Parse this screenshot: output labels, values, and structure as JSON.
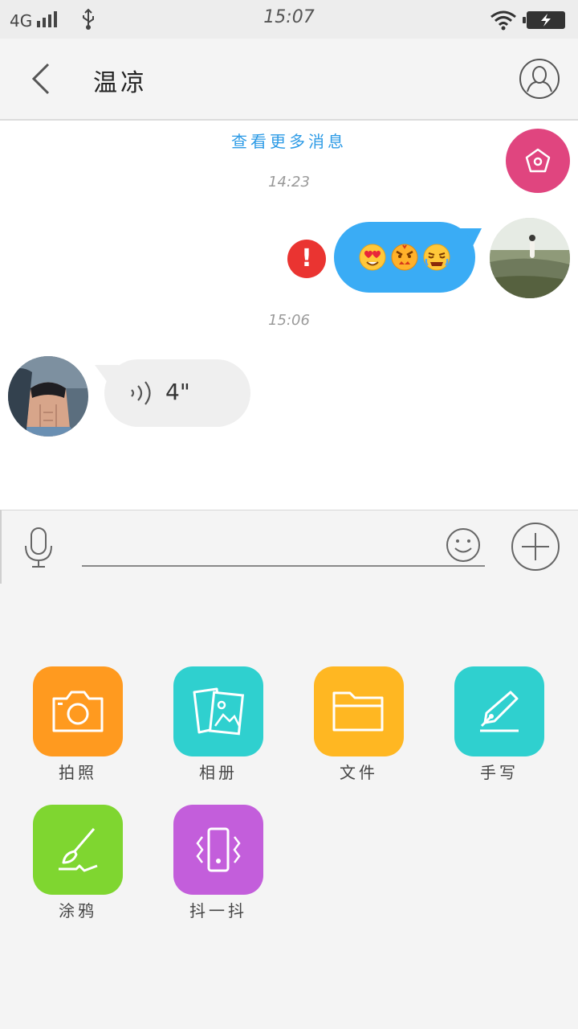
{
  "status_bar": {
    "network": "4G",
    "time": "15:07",
    "icons": [
      "signal-icon",
      "usb-icon",
      "wifi-icon",
      "battery-charging-icon"
    ]
  },
  "header": {
    "title": "温凉",
    "icons": [
      "back-arrow-icon",
      "contact-profile-icon"
    ]
  },
  "chat": {
    "more_messages_link": "查看更多消息",
    "messages": [
      {
        "timestamp": "14:23",
        "direction": "outgoing",
        "type": "emoji",
        "emojis": [
          "heart-eyes-emoji",
          "angry-emoji",
          "crying-emoji"
        ],
        "status": "failed",
        "status_symbol": "!"
      },
      {
        "timestamp": "15:06",
        "direction": "incoming",
        "type": "voice",
        "duration": "4\""
      }
    ],
    "floating_button_icon": "flower-icon"
  },
  "input_bar": {
    "value": "",
    "placeholder": "",
    "icons": [
      "microphone-icon",
      "smiley-icon",
      "plus-circle-icon"
    ]
  },
  "actions": [
    {
      "label": "拍照",
      "icon": "camera-icon",
      "color": "#ff9a1f"
    },
    {
      "label": "相册",
      "icon": "gallery-icon",
      "color": "#2fd0cf"
    },
    {
      "label": "文件",
      "icon": "folder-icon",
      "color": "#ffb722"
    },
    {
      "label": "手写",
      "icon": "pen-icon",
      "color": "#2fd0cf"
    },
    {
      "label": "涂鸦",
      "icon": "brush-icon",
      "color": "#7fd630"
    },
    {
      "label": "抖一抖",
      "icon": "vibrate-phone-icon",
      "color": "#c35edb"
    }
  ],
  "colors": {
    "outgoing_bubble": "#3aacf5",
    "incoming_bubble": "#efefef",
    "error_badge": "#ea3431",
    "link": "#2d9be6",
    "floating_button": "#e0457f"
  }
}
